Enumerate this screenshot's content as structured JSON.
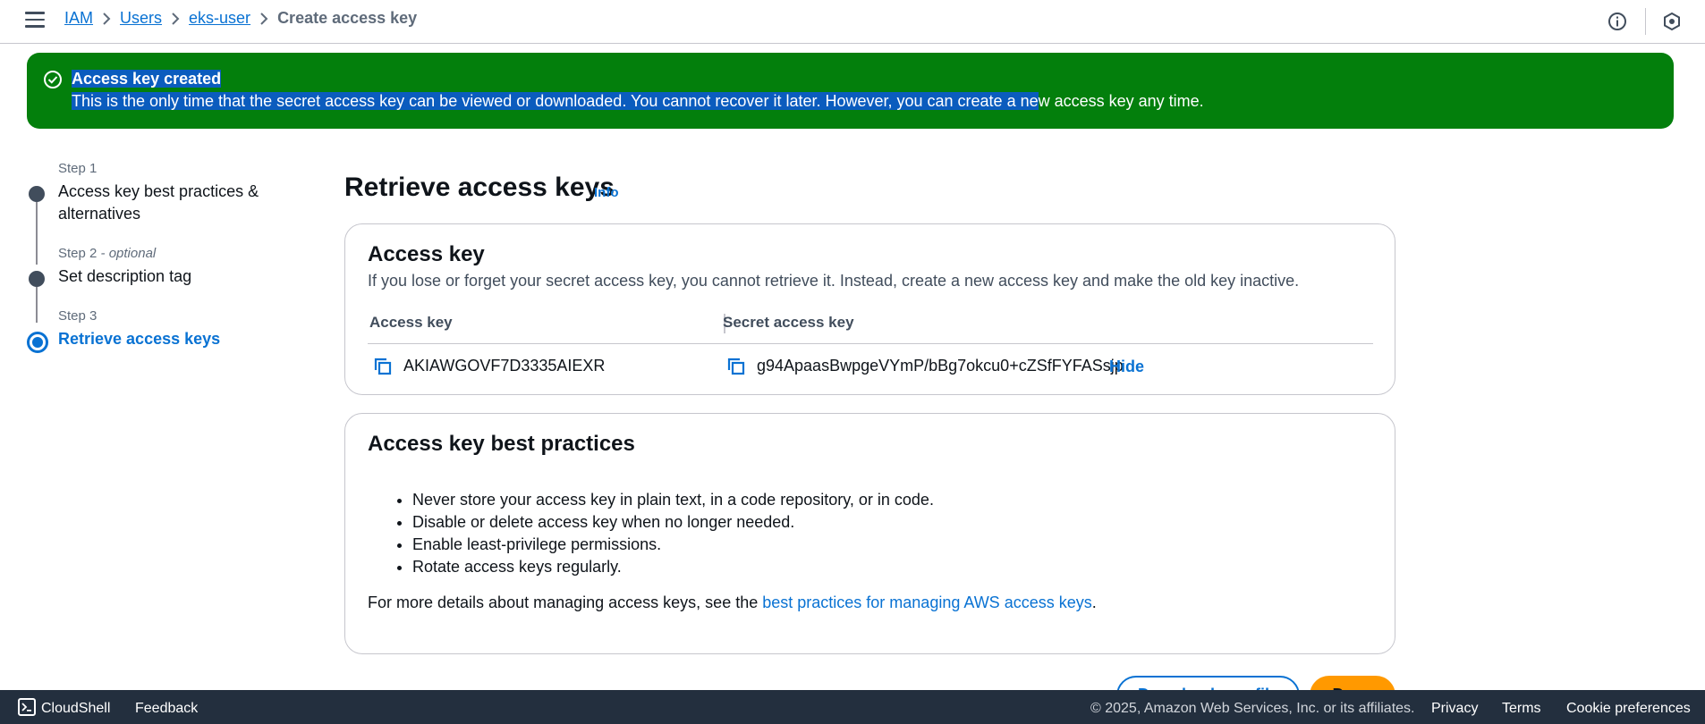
{
  "breadcrumb": {
    "items": [
      "IAM",
      "Users",
      "eks-user"
    ],
    "current": "Create access key"
  },
  "icons": {
    "menu": "hamburger-menu-icon",
    "info": "info-circle-icon",
    "settings": "shield-settings-icon",
    "success": "check-circle-icon",
    "copy": "copy-icon",
    "cloudshell": "cloudshell-icon"
  },
  "flash": {
    "title": "Access key created",
    "message_highlighted": "This is the only time that the secret access key can be viewed or downloaded. You cannot recover it later. However, you can create a ne",
    "message_rest": "w access key any time."
  },
  "steps": [
    {
      "label": "Step 1",
      "label_suffix": "",
      "title": "Access key best practices & alternatives"
    },
    {
      "label": "Step 2",
      "label_suffix": " - optional",
      "title": "Set description tag"
    },
    {
      "label": "Step 3",
      "label_suffix": "",
      "title": "Retrieve access keys"
    }
  ],
  "main": {
    "title": "Retrieve access keys",
    "info_link": "Info",
    "access_key_card": {
      "heading": "Access key",
      "description": "If you lose or forget your secret access key, you cannot retrieve it. Instead, create a new access key and make the old key inactive.",
      "col_access_key": "Access key",
      "col_secret_key": "Secret access key",
      "access_key_value": "AKIAWGOVF7D3335AIEXR",
      "secret_key_value": "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",
      "hide_label": "Hide"
    },
    "best_practices_card": {
      "heading": "Access key best practices",
      "items": [
        "Never store your access key in plain text, in a code repository, or in code.",
        "Disable or delete access key when no longer needed.",
        "Enable least-privilege permissions.",
        "Rotate access keys regularly."
      ],
      "more_prefix": "For more details about managing access keys, see the ",
      "more_link": "best practices for managing AWS access keys",
      "more_suffix": "."
    },
    "buttons": {
      "download": "Download .csv file",
      "done": "Done"
    }
  },
  "footer": {
    "cloudshell": "CloudShell",
    "feedback": "Feedback",
    "copyright": "© 2025, Amazon Web Services, Inc. or its affiliates.",
    "privacy": "Privacy",
    "terms": "Terms",
    "cookie": "Cookie preferences"
  },
  "colors": {
    "success": "#037f0c",
    "link": "#0972d3",
    "primary_button": "#ff9900",
    "footer_bg": "#232f3e"
  }
}
